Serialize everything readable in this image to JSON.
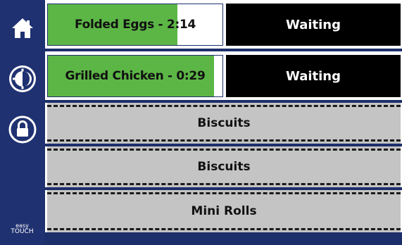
{
  "sidebar": {
    "home_icon": "home-icon",
    "day_night_icon": "day-night-icon",
    "lock_icon": "lock-icon",
    "brand_top": "easy",
    "brand_bottom": "TOUCH"
  },
  "timers": [
    {
      "label": "Folded Eggs - 2:14",
      "status": "Waiting",
      "progress": 0.74
    },
    {
      "label": "Grilled Chicken - 0:29",
      "status": "Waiting",
      "progress": 0.95
    }
  ],
  "products": [
    {
      "label": "Biscuits"
    },
    {
      "label": "Biscuits"
    },
    {
      "label": "Mini Rolls"
    }
  ],
  "colors": {
    "frame": "#1d2f6b",
    "timer_fill": "#5cb646",
    "status_bg": "#000000",
    "product_bg": "#c4c4c4"
  }
}
